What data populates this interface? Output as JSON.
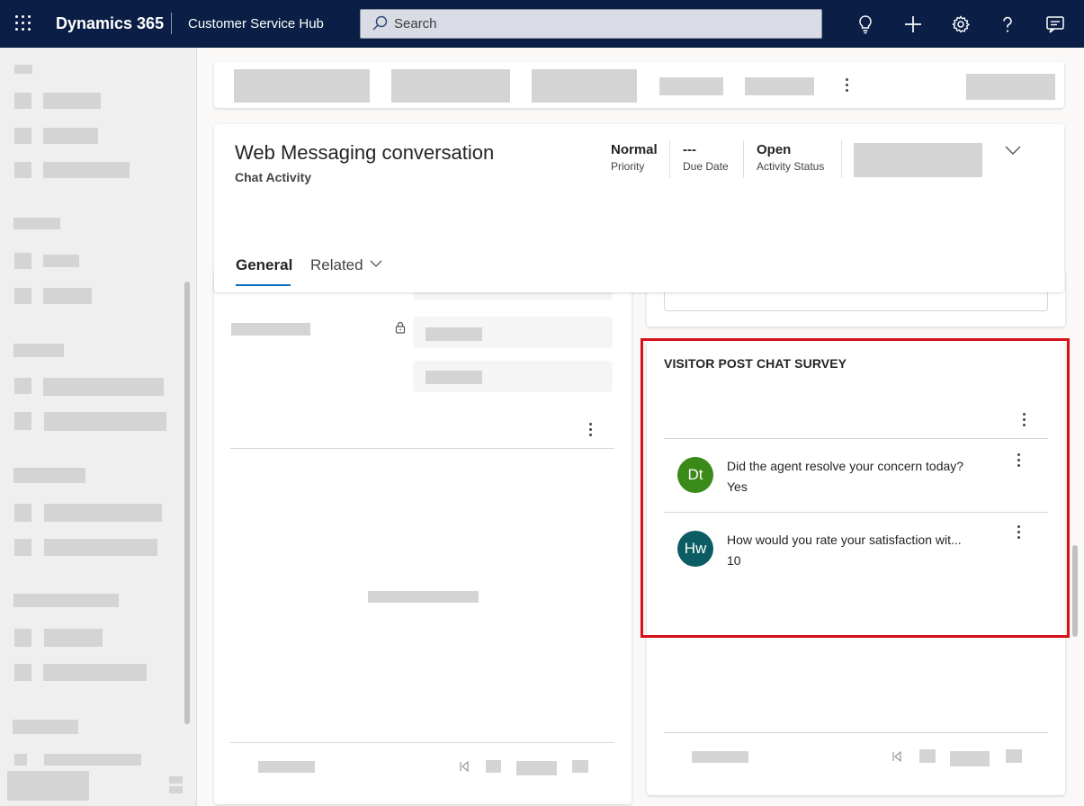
{
  "header": {
    "brand": "Dynamics 365",
    "app_name": "Customer Service Hub",
    "search_placeholder": "Search"
  },
  "record": {
    "title": "Web Messaging conversation",
    "entity": "Chat Activity",
    "fields": [
      {
        "value": "Normal",
        "label": "Priority"
      },
      {
        "value": "---",
        "label": "Due Date"
      },
      {
        "value": "Open",
        "label": "Activity Status"
      }
    ]
  },
  "tabs": [
    {
      "label": "General",
      "selected": true
    },
    {
      "label": "Related",
      "selected": false
    }
  ],
  "survey": {
    "title": "VISITOR POST CHAT SURVEY",
    "items": [
      {
        "initials": "Dt",
        "color": "#3a8a1a",
        "question": "Did the agent resolve your concern today?",
        "answer": "Yes"
      },
      {
        "initials": "Hw",
        "color": "#0b5c63",
        "question": "How would you rate your satisfaction wit...",
        "answer": "10"
      }
    ]
  },
  "colors": {
    "topbar": "#0b1e45",
    "accent": "#0f6cbd",
    "highlight_border": "#d6111a"
  }
}
